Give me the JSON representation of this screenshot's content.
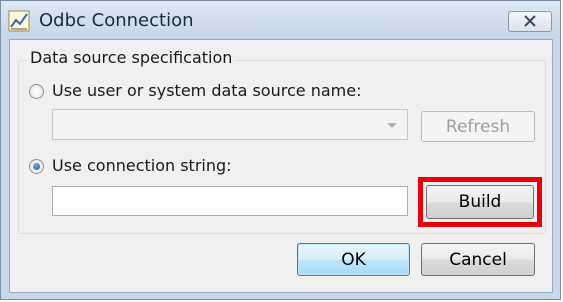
{
  "window": {
    "title": "Odbc Connection"
  },
  "group": {
    "legend": "Data source specification"
  },
  "dsn_option": {
    "label": "Use user or system data source name:",
    "selected": false,
    "value": ""
  },
  "refresh_button": {
    "label": "Refresh",
    "enabled": false
  },
  "conn_option": {
    "label": "Use connection string:",
    "selected": true
  },
  "connection_string": {
    "value": ""
  },
  "build_button": {
    "label": "Build",
    "highlighted": true,
    "highlight_color": "#e8000b"
  },
  "ok_button": {
    "label": "OK"
  },
  "cancel_button": {
    "label": "Cancel"
  },
  "icons": {
    "app": "chart-icon",
    "close": "close-icon",
    "dropdown": "chevron-down-icon"
  }
}
